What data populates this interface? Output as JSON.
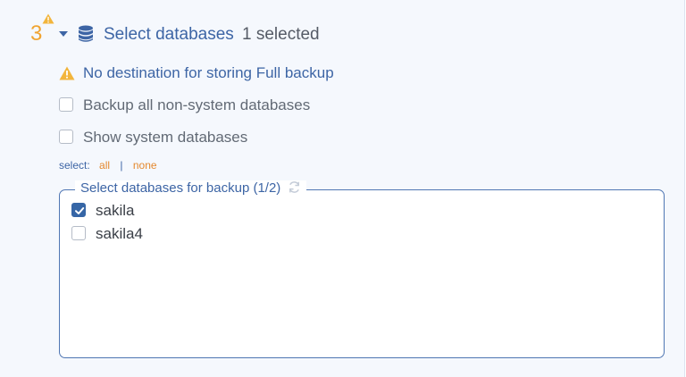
{
  "header": {
    "step_number": "3",
    "title": "Select databases",
    "selected_count": "1 selected"
  },
  "warning": {
    "text": "No destination for storing Full backup"
  },
  "options": {
    "backup_all_label": "Backup all non-system databases",
    "backup_all_checked": false,
    "show_system_label": "Show system databases",
    "show_system_checked": false
  },
  "select_links": {
    "prefix": "select:",
    "all": "all",
    "separator": "|",
    "none": "none"
  },
  "database_box": {
    "legend": "Select databases for backup (1/2)",
    "items": [
      {
        "name": "sakila",
        "checked": true
      },
      {
        "name": "sakila4",
        "checked": false
      }
    ]
  },
  "colors": {
    "accent": "#3d65a5",
    "warning": "#f0a431",
    "link": "#e4892f",
    "panel_bg": "#f5f8fd"
  },
  "icons": {
    "step_warning": "warning-triangle-icon",
    "caret": "caret-down-icon",
    "database": "database-icon",
    "warning": "warning-triangle-icon",
    "refresh": "refresh-icon"
  }
}
